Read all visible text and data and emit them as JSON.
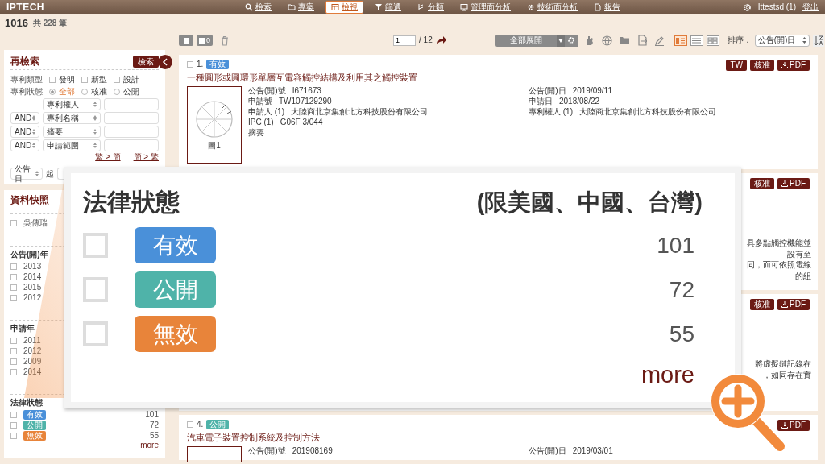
{
  "app": {
    "logo": "IPTECH",
    "user": "Ittestsd (1)",
    "logout": "登出",
    "nav": [
      {
        "label": "檢索",
        "selected": false
      },
      {
        "label": "專案",
        "selected": false
      },
      {
        "label": "檢視",
        "selected": true
      },
      {
        "label": "篩選",
        "selected": false
      },
      {
        "label": "分類",
        "selected": false
      },
      {
        "label": "管理面分析",
        "selected": false
      },
      {
        "label": "技術面分析",
        "selected": false
      },
      {
        "label": "報告",
        "selected": false
      }
    ]
  },
  "summary": {
    "count": "1016",
    "total": "共 228 筆"
  },
  "toolbar": {
    "selected_count": "0",
    "page": "1",
    "pages": "/ 12",
    "expand": "全部展開",
    "sort_label": "排序：",
    "sort_value": "公告(開)日",
    "views": [
      {
        "selected": true
      },
      {
        "selected": false
      },
      {
        "selected": false
      }
    ]
  },
  "search": {
    "title": "再檢索",
    "button": "檢索",
    "type_label": "專利類型",
    "types": [
      {
        "label": "發明",
        "checked": false
      },
      {
        "label": "新型",
        "checked": false
      },
      {
        "label": "設計",
        "checked": false
      }
    ],
    "status_label": "專利狀態",
    "statuses": [
      {
        "label": "全部",
        "selected": true
      },
      {
        "label": "核准",
        "selected": false
      },
      {
        "label": "公開",
        "selected": false
      }
    ],
    "fields": [
      {
        "field": "專利權人"
      },
      {
        "operator": "AND",
        "field": "專利名稱"
      },
      {
        "operator": "AND",
        "field": "摘要"
      },
      {
        "operator": "AND",
        "field": "申請範圍"
      }
    ],
    "convert": [
      "繁 > 簡",
      "簡 > 繁"
    ],
    "date_field": "公告日",
    "date_from": "起"
  },
  "snapshot": {
    "title": "資料快照",
    "groups": [
      {
        "items": [
          {
            "label": "吳傳瑞",
            "checked": false
          }
        ]
      },
      {
        "title": "公告(開)年",
        "items": [
          {
            "label": "2013",
            "checked": false
          },
          {
            "label": "2014",
            "checked": false
          },
          {
            "label": "2015",
            "checked": false
          },
          {
            "label": "2012",
            "checked": false
          }
        ]
      },
      {
        "title": "申請年",
        "items": [
          {
            "label": "2011",
            "checked": false
          },
          {
            "label": "2012",
            "checked": false
          },
          {
            "label": "2009",
            "checked": false
          },
          {
            "label": "2014",
            "checked": false
          }
        ]
      },
      {
        "title": "法律狀態",
        "more": "more",
        "items": [
          {
            "label": "有效",
            "color": "#4a90d9",
            "count": "101",
            "checked": false
          },
          {
            "label": "公開",
            "color": "#4fb3a9",
            "count": "72",
            "checked": false
          },
          {
            "label": "無效",
            "color": "#e8843a",
            "count": "55",
            "checked": false
          }
        ]
      }
    ]
  },
  "results": [
    {
      "kind": "full",
      "checked": false,
      "number": "1.",
      "status": {
        "label": "有效",
        "color": "#4a90d9"
      },
      "buttons": [
        "TW",
        "核准",
        "PDF"
      ],
      "title": "一種圓形或圓環形單層互電容觸控結構及利用其之觸控裝置",
      "figure_caption": "圖1",
      "left": [
        {
          "label": "公告(開)號",
          "value": "I671673"
        },
        {
          "label": "申請號",
          "value": "TW107129290"
        },
        {
          "label": "申請人 (1)",
          "value": "大陸商北京集創北方科技股份有限公司"
        },
        {
          "label": "IPC (1)",
          "value": "G06F 3/044"
        },
        {
          "label": "摘要"
        }
      ],
      "right": [
        {
          "label": "公告(開)日",
          "value": "2019/09/11"
        },
        {
          "label": "申請日",
          "value": "2018/08/22"
        },
        {
          "label": "專利權人 (1)",
          "value": "大陸商北京集創北方科技股份有限公司"
        }
      ]
    },
    {
      "kind": "covered",
      "buttons": [
        "核准",
        "PDF"
      ],
      "abstract": [
        "具多點觸控機能並設有至",
        "同，而可依照電線的組"
      ]
    },
    {
      "kind": "covered",
      "buttons": [
        "核准",
        "PDF"
      ],
      "abstract": [
        "將虛擬鏈記錄在",
        "，如同存在實"
      ]
    },
    {
      "kind": "full",
      "checked": false,
      "number": "4.",
      "status": {
        "label": "公開",
        "color": "#4fb3a9"
      },
      "buttons": [
        "PDF"
      ],
      "title": "汽車電子裝置控制系統及控制方法",
      "left": [
        {
          "label": "公告(開)號",
          "value": "201908169"
        }
      ],
      "right": [
        {
          "label": "公告(開)日",
          "value": "2019/03/01"
        }
      ]
    }
  ],
  "callout": {
    "title": "法律狀態",
    "note": "(限美國、中國、台灣)",
    "more": "more",
    "rows": [
      {
        "label": "有效",
        "color": "#4a90d9",
        "count": "101",
        "checked": false
      },
      {
        "label": "公開",
        "color": "#4fb3a9",
        "count": "72",
        "checked": false
      },
      {
        "label": "無效",
        "color": "#e8843a",
        "count": "55",
        "checked": false
      }
    ]
  }
}
